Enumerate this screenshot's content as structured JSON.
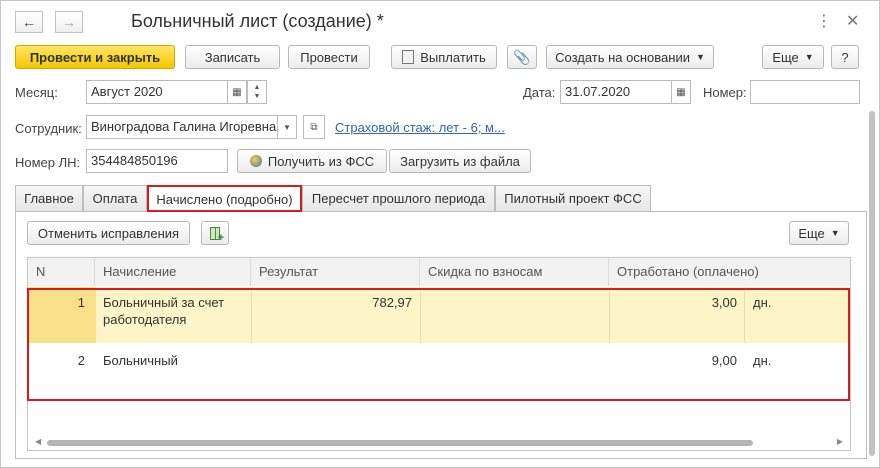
{
  "window": {
    "title": "Больничный лист (создание) *",
    "more_icon": "⋮",
    "close_icon": "✕",
    "back_icon": "←",
    "forward_icon": "→"
  },
  "toolbar": {
    "post_close": "Провести и закрыть",
    "save": "Записать",
    "post": "Провести",
    "pay": "Выплатить",
    "create_based": "Создать на основании",
    "more": "Еще",
    "help": "?"
  },
  "form": {
    "month_label": "Месяц:",
    "month_value": "Август 2020",
    "date_label": "Дата:",
    "date_value": "31.07.2020",
    "number_label": "Номер:",
    "number_value": "",
    "employee_label": "Сотрудник:",
    "employee_value": "Виноградова Галина Игоревна",
    "insurance_link": "Страховой стаж: лет - 6; м...",
    "ln_label": "Номер ЛН:",
    "ln_value": "354484850196",
    "get_fss": "Получить из ФСС",
    "load_file": "Загрузить из файла"
  },
  "tabs": [
    {
      "label": "Главное"
    },
    {
      "label": "Оплата"
    },
    {
      "label": "Начислено (подробно)"
    },
    {
      "label": "Пересчет прошлого периода"
    },
    {
      "label": "Пилотный проект ФСС"
    }
  ],
  "panel": {
    "cancel_corrections": "Отменить исправления",
    "more": "Еще"
  },
  "grid": {
    "columns": [
      "N",
      "Начисление",
      "Результат",
      "Скидка по взносам",
      "Отработано (оплачено)"
    ],
    "rows": [
      {
        "n": "1",
        "accrual_line1": "Больничный за счет",
        "accrual_line2": "работодателя",
        "result": "782,97",
        "discount": "",
        "worked": "3,00",
        "unit": "дн."
      },
      {
        "n": "2",
        "accrual_line1": "Больничный",
        "accrual_line2": "",
        "result": "",
        "discount": "",
        "worked": "9,00",
        "unit": "дн."
      }
    ]
  },
  "colors": {
    "primary_button": "#f5c800",
    "highlight": "#d81b1b",
    "selected_row": "#fdf4c8",
    "link": "#3366aa"
  }
}
